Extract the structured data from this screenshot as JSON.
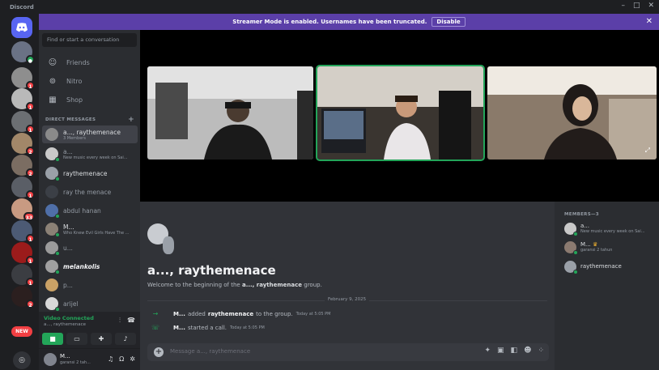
{
  "app": {
    "name": "Discord"
  },
  "window": {
    "minimize": "–",
    "maximize": "□",
    "close": "✕"
  },
  "banner": {
    "text": "Streamer Mode is enabled. Usernames have been truncated.",
    "disable_label": "Disable",
    "close": "✕"
  },
  "rail": {
    "badges": [
      "1",
      "1",
      "1",
      "2",
      "2",
      "1",
      "33",
      "1",
      "1",
      "1",
      "2"
    ],
    "new_label": "NEW"
  },
  "sidebar": {
    "search_placeholder": "Find or start a conversation",
    "nav": [
      "Friends",
      "Nitro",
      "Shop"
    ],
    "dm_header": "DIRECT MESSAGES",
    "dm_add": "+",
    "dms": [
      {
        "name": "a..., raythemenace",
        "sub": "3 Members",
        "active": true
      },
      {
        "name": "a...",
        "sub": "New music every week on Sai..."
      },
      {
        "name": "raythemenace",
        "sub": ""
      },
      {
        "name": "ray the menace",
        "sub": ""
      },
      {
        "name": "abdul hanan",
        "sub": ""
      },
      {
        "name": "M...",
        "sub": "Who Knew Evil Girls Have The ..."
      },
      {
        "name": "u...",
        "sub": ""
      },
      {
        "name": "melankolis",
        "sub": ""
      },
      {
        "name": "p...",
        "sub": ""
      },
      {
        "name": "arijel",
        "sub": ""
      }
    ]
  },
  "voice": {
    "title": "Video Connected",
    "channel": "a..., raythemenace"
  },
  "user": {
    "name": "M...",
    "status": "garansi 2 tah..."
  },
  "chat": {
    "title": "a..., raythemenace",
    "welcome_prefix": "Welcome to the beginning of the",
    "welcome_group": "a..., raythemenace",
    "welcome_suffix": "group.",
    "date": "February 9, 2025",
    "events": [
      {
        "actor": "M...",
        "action": "added",
        "target": "raythemenace",
        "tail": "to the group.",
        "time": "Today at 5:05 PM"
      },
      {
        "actor": "M...",
        "action": "started a call.",
        "target": "",
        "tail": "",
        "time": "Today at 5:05 PM"
      }
    ],
    "composer_placeholder": "Message a..., raythemenace"
  },
  "members": {
    "header": "MEMBERS—3",
    "list": [
      {
        "name": "a...",
        "sub": "New music every week on Sai..."
      },
      {
        "name": "M...",
        "sub": "garansi 2 tahun"
      },
      {
        "name": "raythemenace",
        "sub": ""
      }
    ]
  },
  "colors": {
    "accent": "#5865f2",
    "online": "#23a559",
    "banner": "#5b3fa8",
    "badge": "#f23f43"
  }
}
